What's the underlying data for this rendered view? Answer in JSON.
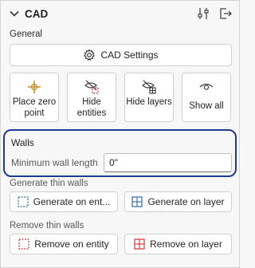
{
  "header": {
    "title": "CAD",
    "icons": [
      "chevron-down-icon",
      "sliders-icon",
      "exit-icon"
    ]
  },
  "general": {
    "label": "General",
    "cad_settings_label": "CAD Settings"
  },
  "tiles": [
    {
      "label": "Place zero point",
      "icon": "crosshair-icon"
    },
    {
      "label": "Hide entities",
      "icon": "hide-entities-icon"
    },
    {
      "label": "Hide layers",
      "icon": "hide-layers-icon"
    },
    {
      "label": "Show all",
      "icon": "eye-icon"
    }
  ],
  "walls": {
    "title": "Walls",
    "min_length_label": "Minimum wall length",
    "min_length_value": "0\""
  },
  "generate_thin_walls": {
    "label": "Generate thin walls",
    "on_entity_label": "Generate on ent...",
    "on_layer_label": "Generate on layer"
  },
  "remove_thin_walls": {
    "label": "Remove thin walls",
    "on_entity_label": "Remove on entity",
    "on_layer_label": "Remove on layer"
  },
  "colors": {
    "accent": "#1f3a93",
    "remove_red": "#d13438",
    "generate_blue": "#2b6cb0",
    "crosshair_orange": "#c98a1a"
  }
}
